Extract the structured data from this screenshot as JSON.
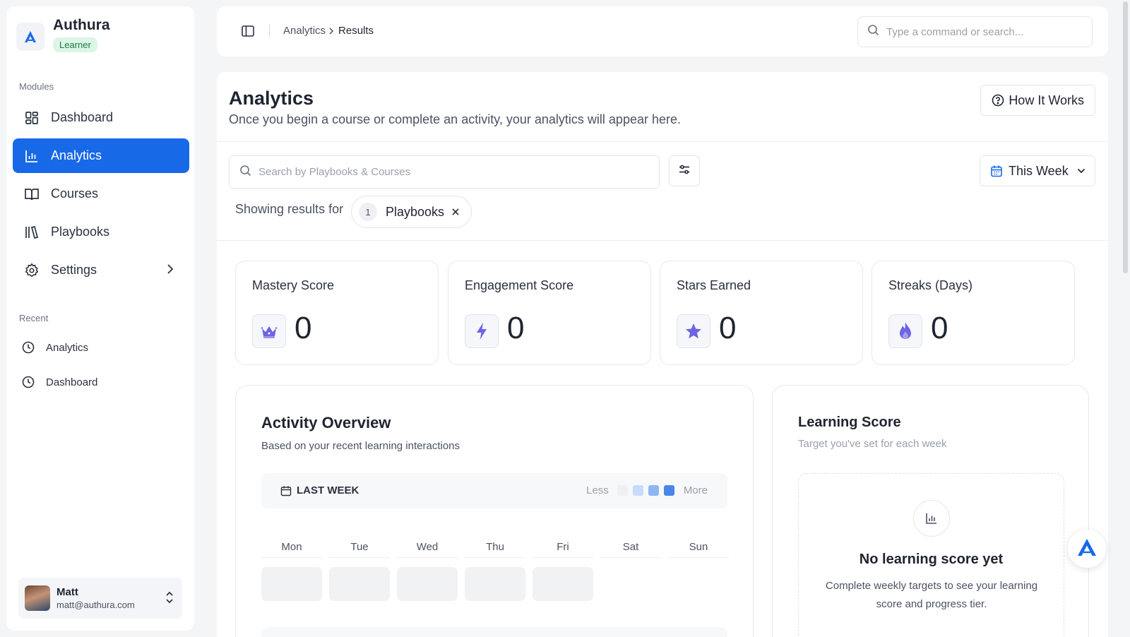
{
  "brand": {
    "name": "Authura",
    "role_badge": "Learner"
  },
  "sidebar": {
    "modules_label": "Modules",
    "items": [
      {
        "label": "Dashboard",
        "icon": "dashboard-icon"
      },
      {
        "label": "Analytics",
        "icon": "bar-chart-icon",
        "active": true
      },
      {
        "label": "Courses",
        "icon": "book-open-icon"
      },
      {
        "label": "Playbooks",
        "icon": "library-icon"
      },
      {
        "label": "Settings",
        "icon": "gear-icon",
        "has_submenu": true
      }
    ],
    "recent_label": "Recent",
    "recent": [
      {
        "label": "Analytics",
        "icon": "clock-icon"
      },
      {
        "label": "Dashboard",
        "icon": "clock-icon"
      }
    ]
  },
  "user": {
    "name": "Matt",
    "email": "matt@authura.com"
  },
  "topbar": {
    "breadcrumb": [
      "Analytics",
      "Results"
    ],
    "search_placeholder": "Type a command or search..."
  },
  "page": {
    "title": "Analytics",
    "subtitle": "Once you begin a course or complete an activity, your analytics will appear here.",
    "how_it_works": "How It Works",
    "search_placeholder": "Search by Playbooks & Courses",
    "period": "This Week",
    "showing_label": "Showing results for",
    "filter_chip": {
      "count": "1",
      "label": "Playbooks"
    }
  },
  "stats": [
    {
      "label": "Mastery Score",
      "value": "0",
      "icon": "crown-icon"
    },
    {
      "label": "Engagement Score",
      "value": "0",
      "icon": "lightning-icon"
    },
    {
      "label": "Stars Earned",
      "value": "0",
      "icon": "star-icon"
    },
    {
      "label": "Streaks (Days)",
      "value": "0",
      "icon": "flame-icon"
    }
  ],
  "activity": {
    "title": "Activity Overview",
    "subtitle": "Based on your recent learning interactions",
    "range_label": "LAST WEEK",
    "legend_less": "Less",
    "legend_more": "More",
    "days": [
      "Mon",
      "Tue",
      "Wed",
      "Thu",
      "Fri",
      "Sat",
      "Sun"
    ]
  },
  "learning_score": {
    "title": "Learning Score",
    "subtitle": "Target you've set for each week",
    "empty_title": "No learning score yet",
    "empty_text": "Complete weekly targets to see your learning score and progress tier."
  },
  "colors": {
    "accent": "#1769e8",
    "badge_bg": "#dcf5e6",
    "legend_scale": [
      "#eef0f4",
      "#c9dbfb",
      "#8fb6f3",
      "#4a86e8"
    ]
  }
}
